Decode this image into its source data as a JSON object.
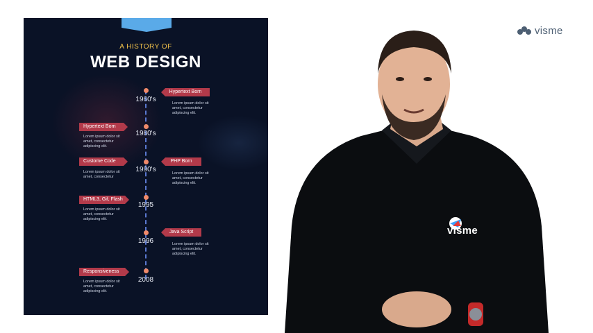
{
  "infographic": {
    "pre_title": "A HISTORY OF",
    "title": "WEB DESIGN",
    "entries": [
      {
        "year": "1960's",
        "tag": "Hypertext Born",
        "desc": "Lorem ipsum dolor sit amet, consectetur adipiscing elit.",
        "side": "right"
      },
      {
        "year": "1980's",
        "tag": "Hypertext Born",
        "desc": "Lorem ipsum dolor sit amet, consectetur adipiscing elit.",
        "side": "left"
      },
      {
        "year": "1990's",
        "tag": "Custome Code",
        "desc": "Lorem ipsum dolor sit amet, consectetur",
        "side": "left",
        "tag2": "PHP Born",
        "desc2": "Lorem ipsum dolor sit amet, consectetur adipiscing elit."
      },
      {
        "year": "1995",
        "tag": "HTML3, Gif, Flash",
        "desc": "Lorem ipsum dolor sit amet, consectetur adipiscing elit.",
        "side": "left"
      },
      {
        "year": "1996",
        "tag": "Java Script",
        "desc": "Lorem ipsum dolor sit amet, consectetur adipiscing elit.",
        "side": "right"
      },
      {
        "year": "2008",
        "tag": "Responsiveness",
        "desc": "Lorem ipsum dolor sit amet, consectetur adipiscing elit.",
        "side": "left"
      }
    ]
  },
  "brand": {
    "logo_text": "visme",
    "shirt_text": "visme"
  },
  "colors": {
    "panel_bg": "#0a1226",
    "tag": "#b23a4a",
    "dot": "#f08a6a",
    "timeline": "#5a78d0",
    "banner": "#5aaae8",
    "pre_title": "#f2c24a"
  },
  "icons": [
    "visme-logo-icon",
    "presenter-photo"
  ]
}
